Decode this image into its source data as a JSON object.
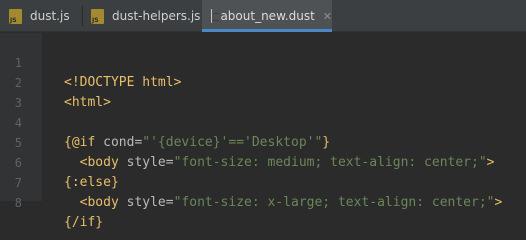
{
  "tabs": [
    {
      "label": "dust.js",
      "icon": "js-file-icon",
      "icon_text": "JS",
      "active": false
    },
    {
      "label": "dust-helpers.js",
      "icon": "js-file-icon",
      "icon_text": "JS",
      "active": false
    },
    {
      "label": "about_new.dust",
      "icon": "dust-file-icon",
      "active": true
    }
  ],
  "close_glyph": "✕",
  "line_numbers": [
    "1",
    "2",
    "3",
    "4",
    "5",
    "6",
    "7",
    "8"
  ],
  "code": {
    "l1": "<!DOCTYPE html>",
    "l2": "<html>",
    "l3": "",
    "l4": {
      "open": "{@if ",
      "attr": "cond=",
      "str": "\"'{device}'=='Desktop'\"",
      "close": "}"
    },
    "l5": {
      "indent": "  ",
      "open": "<body ",
      "attr": "style=",
      "str": "\"font-size: medium; text-align: center;\"",
      "close": ">"
    },
    "l6": "{:else}",
    "l7": {
      "indent": "  ",
      "open": "<body ",
      "attr": "style=",
      "str": "\"font-size: x-large; text-align: center;\"",
      "close": ">"
    },
    "l8": "{/if}"
  },
  "colors": {
    "background": "#2b2b2b",
    "gutter": "#313335",
    "tabbar": "#3c3f41",
    "active_tab": "#4e5254",
    "active_underline": "#4a88c7",
    "tag": "#e8bf6a",
    "string": "#6a8759",
    "attribute": "#bababa",
    "line_number": "#606366"
  }
}
